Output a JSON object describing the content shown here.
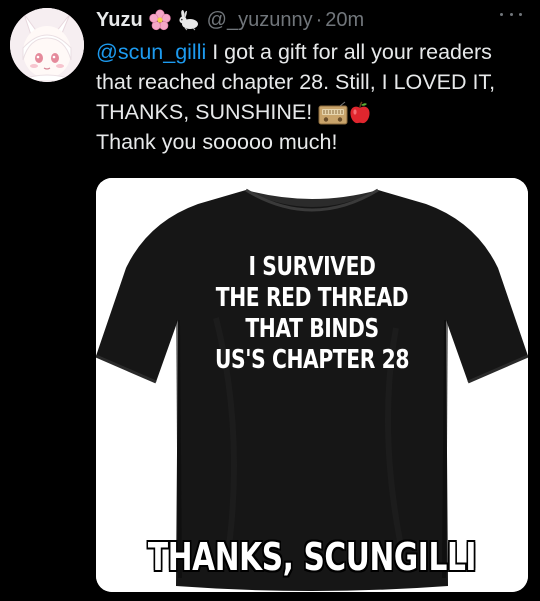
{
  "user": {
    "display_name": "Yuzu",
    "name_emojis": [
      "cherry-blossom-icon",
      "rabbit-icon"
    ],
    "handle": "@_yuzunny",
    "separator": "·",
    "time": "20m"
  },
  "tweet": {
    "mention": "@scun_gilli",
    "line1_rest": " I got a gift for all your readers that reached chapter 28. Still, I LOVED IT, THANKS, SUNSHINE! ",
    "line_end": "Thank you sooooo much!",
    "inline_emojis": [
      "radio-icon",
      "red-apple-icon"
    ]
  },
  "media": {
    "shirt_text_lines": [
      "I SURVIVED",
      "THE RED THREAD",
      "THAT BINDS",
      "US'S CHAPTER 28"
    ],
    "shirt_bottom_text": "THANKS, SCUNGILLI"
  },
  "colors": {
    "background": "#000000",
    "text": "#e7e9ea",
    "muted": "#71767b",
    "link": "#1d9bf0"
  }
}
